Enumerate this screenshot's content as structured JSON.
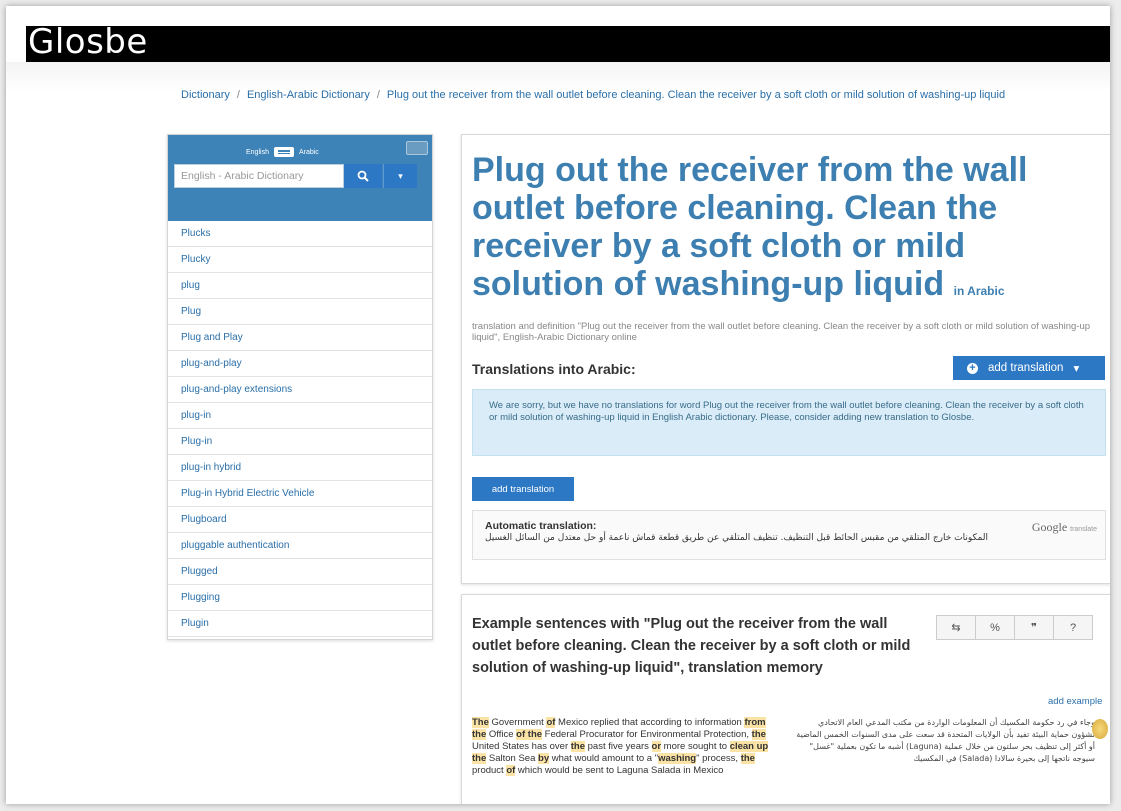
{
  "app": {
    "logo": "Glosbe"
  },
  "breadcrumb": {
    "items": [
      "Dictionary",
      "English-Arabic Dictionary",
      "Plug out the receiver from the wall outlet before cleaning. Clean the receiver by a soft cloth or mild solution of washing-up liquid"
    ],
    "separator": "/"
  },
  "sidebar": {
    "lang_from": "English",
    "lang_to": "Arabic",
    "search_placeholder": "English - Arabic Dictionary",
    "items": [
      "Plucks",
      "Plucky",
      "plug",
      "Plug",
      "Plug and Play",
      "plug-and-play",
      "plug-and-play extensions",
      "plug-in",
      "Plug-in",
      "plug-in hybrid",
      "Plug-in Hybrid Electric Vehicle",
      "Plugboard",
      "pluggable authentication",
      "Plugged",
      "Plugging",
      "Plugin"
    ]
  },
  "main": {
    "title": "Plug out the receiver from the wall outlet before cleaning. Clean the receiver by a soft cloth or mild solution of washing-up liquid",
    "title_suffix": "in Arabic",
    "description": "translation and definition \"Plug out the receiver from the wall outlet before cleaning. Clean the receiver by a soft cloth or mild solution of washing-up liquid\", English-Arabic Dictionary online",
    "translations_heading": "Translations into Arabic:",
    "add_translation_top": "add translation",
    "sorry_message": "We are sorry, but we have no translations for word Plug out the receiver from the wall outlet before cleaning. Clean the receiver by a soft cloth or mild solution of washing-up liquid in English Arabic dictionary. Please, consider adding new translation to Glosbe.",
    "add_translation_button": "add translation",
    "auto_label": "Automatic translation:",
    "auto_text": "المكونات خارج المتلقي من مقبس الحائط قبل التنظيف. تنظيف المتلقي عن طريق قطعة قماش ناعمة أو حل معتدل من السائل الغسيل",
    "google_label": "Google",
    "google_suffix": "translate"
  },
  "examples": {
    "heading": "Example sentences with \"Plug out the receiver from the wall outlet before cleaning. Clean the receiver by a soft cloth or mild solution of washing-up liquid\", translation memory",
    "add_example": "add example",
    "toolbar_icons": [
      "refresh-icon",
      "link-icon",
      "quote-icon",
      "help-icon"
    ],
    "toolbar_glyphs": [
      "⇆",
      "%",
      "❞",
      "?"
    ],
    "en_parts": [
      {
        "t": "The",
        "hl": true
      },
      {
        "t": " Government ",
        "hl": false
      },
      {
        "t": "of",
        "hl": true
      },
      {
        "t": " Mexico replied that according to information ",
        "hl": false
      },
      {
        "t": "from the",
        "hl": true
      },
      {
        "t": " Office ",
        "hl": false
      },
      {
        "t": "of the",
        "hl": true
      },
      {
        "t": " Federal Procurator for Environmental Protection, ",
        "hl": false
      },
      {
        "t": "the",
        "hl": true
      },
      {
        "t": " United States has over ",
        "hl": false
      },
      {
        "t": "the",
        "hl": true
      },
      {
        "t": " past five years ",
        "hl": false
      },
      {
        "t": "or",
        "hl": true
      },
      {
        "t": " more sought to ",
        "hl": false
      },
      {
        "t": "clean up the",
        "hl": true
      },
      {
        "t": " Salton Sea ",
        "hl": false
      },
      {
        "t": "by",
        "hl": true
      },
      {
        "t": " what would amount to a \"",
        "hl": false
      },
      {
        "t": "washing",
        "hl": true
      },
      {
        "t": "\" process, ",
        "hl": false
      },
      {
        "t": "the",
        "hl": true
      },
      {
        "t": " product ",
        "hl": false
      },
      {
        "t": "of",
        "hl": true
      },
      {
        "t": " which would be sent to Laguna Salada in Mexico",
        "hl": false
      }
    ],
    "ar_text": "وجاء في رد حكومة المكسيك أن المعلومات الواردة من مكتب المدعي العام الاتحادي لشؤون حماية البيئة تفيد بأن الولايات المتحدة قد سعت على مدى السنوات الخمس الماضية أو أكثر إلى تنظيف بحر سلتون من خلال عملية (Laguna) أشبه ما تكون بعملية \"غسل\" سيوجه ناتجها إلى بحيرة سالادا (Salada) في المكسيك"
  }
}
